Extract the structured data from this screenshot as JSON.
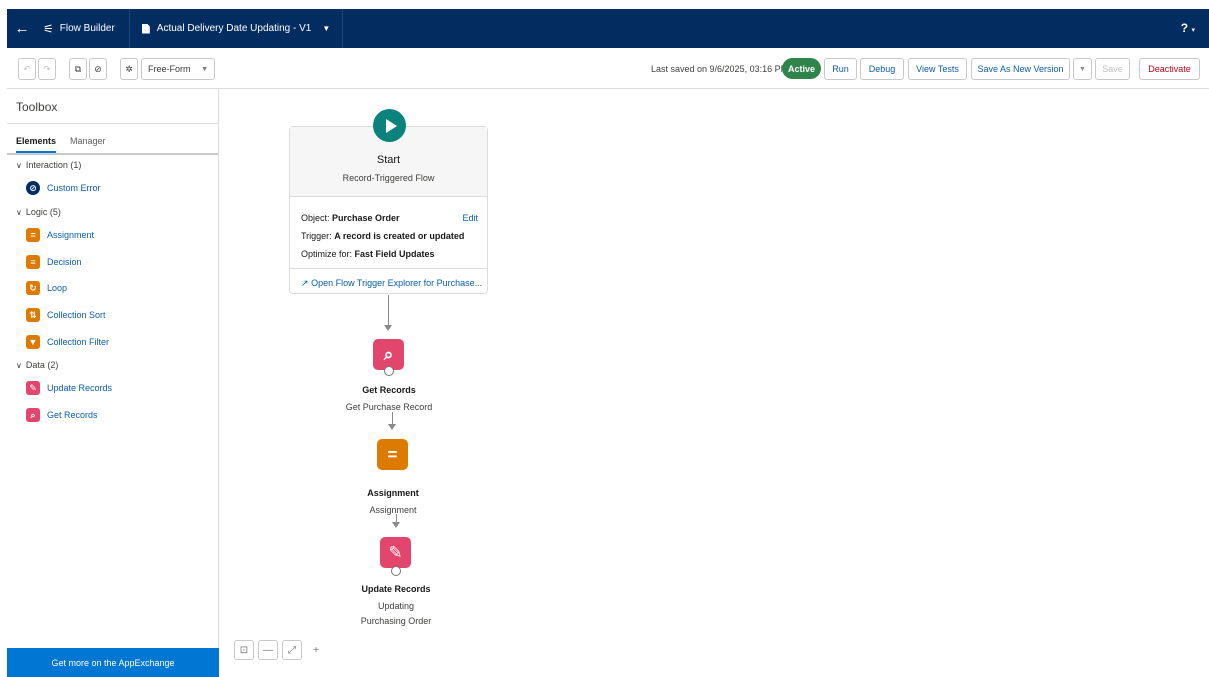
{
  "topnav": {
    "back_icon": "←",
    "app_name": "Flow Builder",
    "flow_tab": "Actual Delivery Date Updating - V1",
    "help": "?"
  },
  "toolbar": {
    "undo": "↶",
    "redo": "↷",
    "copy_icon": "⧉",
    "block_icon": "⊘",
    "gear_icon": "✲",
    "layout": "Free-Form",
    "last_saved": "Last saved on 9/6/2025, 03:16 PM",
    "status": "Active",
    "run": "Run",
    "debug": "Debug",
    "view_tests": "View Tests",
    "save_as_new": "Save As New Version",
    "save": "Save",
    "deactivate": "Deactivate"
  },
  "sidebar": {
    "title": "Toolbox",
    "tabs": {
      "elements": "Elements",
      "manager": "Manager"
    },
    "sections": [
      {
        "label": "Interaction (1)"
      },
      {
        "label": "Logic (5)"
      },
      {
        "label": "Data (2)"
      }
    ],
    "items": [
      {
        "label": "Custom Error",
        "color": "#032d60"
      },
      {
        "label": "Assignment",
        "color": "#dd7a01"
      },
      {
        "label": "Decision",
        "color": "#dd7a01"
      },
      {
        "label": "Loop",
        "color": "#dd7a01"
      },
      {
        "label": "Collection Sort",
        "color": "#dd7a01"
      },
      {
        "label": "Collection Filter",
        "color": "#dd7a01"
      },
      {
        "label": "Update Records",
        "color": "#e3466c"
      },
      {
        "label": "Get Records",
        "color": "#e3466c"
      }
    ],
    "appexchange": "Get more on the AppExchange"
  },
  "canvas": {
    "start": {
      "title": "Start",
      "subtitle": "Record-Triggered Flow",
      "object_label": "Object:",
      "object_value": "Purchase Order",
      "edit": "Edit",
      "trigger_label": "Trigger:",
      "trigger_value": "A record is created or updated",
      "optimize_label": "Optimize for:",
      "optimize_value": "Fast Field Updates",
      "explorer_link": "Open Flow Trigger Explorer for Purchase..."
    },
    "nodes": [
      {
        "title": "Get Records",
        "subtitle": "Get Purchase Record"
      },
      {
        "title": "Assignment",
        "subtitle": "Assignment"
      },
      {
        "title": "Update Records",
        "subtitle": "Updating Purchasing Order"
      }
    ]
  }
}
